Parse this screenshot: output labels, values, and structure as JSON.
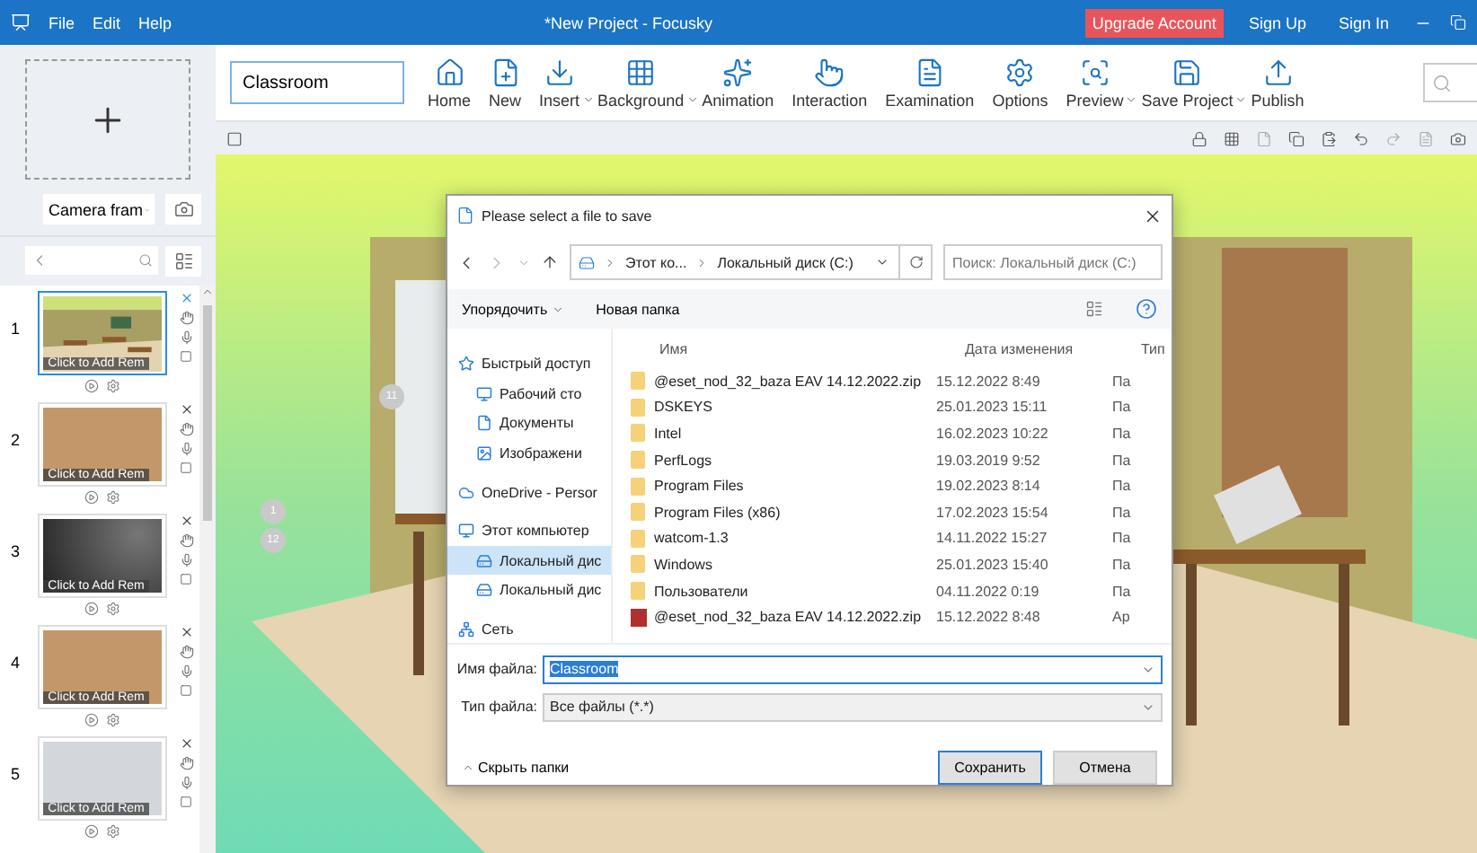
{
  "window": {
    "title": "*New Project - Focusky",
    "menu": [
      "File",
      "Edit",
      "Help"
    ],
    "account": [
      {
        "label": "Upgrade Account",
        "kind": "highlight"
      },
      {
        "label": "Sign Up",
        "kind": "plain"
      },
      {
        "label": "Sign In",
        "kind": "plain"
      }
    ]
  },
  "toolbar": {
    "project_name": "Classroom",
    "items": [
      {
        "label": "Home",
        "dropdown": false
      },
      {
        "label": "New",
        "dropdown": false
      },
      {
        "label": "Insert",
        "dropdown": true
      },
      {
        "label": "Background",
        "dropdown": true
      },
      {
        "label": "Animation",
        "dropdown": false
      },
      {
        "label": "Interaction",
        "dropdown": false
      },
      {
        "label": "Examination",
        "dropdown": false
      },
      {
        "label": "Options",
        "dropdown": false
      },
      {
        "label": "Preview",
        "dropdown": true
      },
      {
        "label": "Save Project",
        "dropdown": true
      },
      {
        "label": "Publish",
        "dropdown": false
      }
    ]
  },
  "sidebar": {
    "frame_type": "Camera fram",
    "slides": [
      {
        "number": "1",
        "caption": "Click to Add Rem",
        "selected": true,
        "kind": "picture"
      },
      {
        "number": "2",
        "caption": "Click to Add Rem",
        "selected": false,
        "kind": "color",
        "color": "#c4976a"
      },
      {
        "number": "3",
        "caption": "Click to Add Rem",
        "selected": false,
        "kind": "dark"
      },
      {
        "number": "4",
        "caption": "Click to Add Rem",
        "selected": false,
        "kind": "color",
        "color": "#c4976a"
      },
      {
        "number": "5",
        "caption": "Click to Add Rem",
        "selected": false,
        "kind": "color",
        "color": "#d3d7dc"
      }
    ]
  },
  "canvas": {
    "markers": [
      "11",
      "1",
      "12"
    ]
  },
  "dialog": {
    "title": "Please select a file to save",
    "breadcrumb": [
      "Этот ко...",
      "Локальный диск (C:)"
    ],
    "search": {
      "placeholder": "Поиск: Локальный диск (C:)"
    },
    "commands": [
      "Упорядочить",
      "Новая папка"
    ],
    "nav": [
      {
        "label": "Быстрый доступ",
        "selected": false
      },
      {
        "label": "Рабочий сто",
        "selected": false
      },
      {
        "label": "Документы",
        "selected": false
      },
      {
        "label": "Изображени",
        "selected": false
      },
      {
        "label": "OneDrive - Persor",
        "selected": false
      },
      {
        "label": "Этот компьютер",
        "selected": false
      },
      {
        "label": "Локальный дис",
        "selected": true
      },
      {
        "label": "Локальный дис",
        "selected": false
      },
      {
        "label": "Сеть",
        "selected": false
      }
    ],
    "columns": [
      "Имя",
      "Дата изменения",
      "Тип"
    ],
    "files": [
      {
        "name": "@eset_nod_32_baza EAV 14.12.2022.zip",
        "date": "15.12.2022 8:49",
        "type": "Па",
        "kind": "folder"
      },
      {
        "name": "DSKEYS",
        "date": "25.01.2023 15:11",
        "type": "Па",
        "kind": "folder"
      },
      {
        "name": "Intel",
        "date": "16.02.2023 10:22",
        "type": "Па",
        "kind": "folder"
      },
      {
        "name": "PerfLogs",
        "date": "19.03.2019 9:52",
        "type": "Па",
        "kind": "folder"
      },
      {
        "name": "Program Files",
        "date": "19.02.2023 8:14",
        "type": "Па",
        "kind": "folder"
      },
      {
        "name": "Program Files (x86)",
        "date": "17.02.2023 15:54",
        "type": "Па",
        "kind": "folder"
      },
      {
        "name": "watcom-1.3",
        "date": "14.11.2022 15:27",
        "type": "Па",
        "kind": "folder"
      },
      {
        "name": "Windows",
        "date": "25.01.2023 15:40",
        "type": "Па",
        "kind": "folder"
      },
      {
        "name": "Пользователи",
        "date": "04.11.2022 0:19",
        "type": "Па",
        "kind": "folder"
      },
      {
        "name": "@eset_nod_32_baza EAV 14.12.2022.zip",
        "date": "15.12.2022 8:48",
        "type": "Ар",
        "kind": "archive"
      }
    ],
    "file_name_label": "Имя файла:",
    "file_name": "Classroom",
    "file_type_label": "Тип файла:",
    "file_type": "Все файлы (*.*)",
    "hide_folders": "Скрыть папки",
    "buttons": [
      "Сохранить",
      "Отмена"
    ]
  }
}
